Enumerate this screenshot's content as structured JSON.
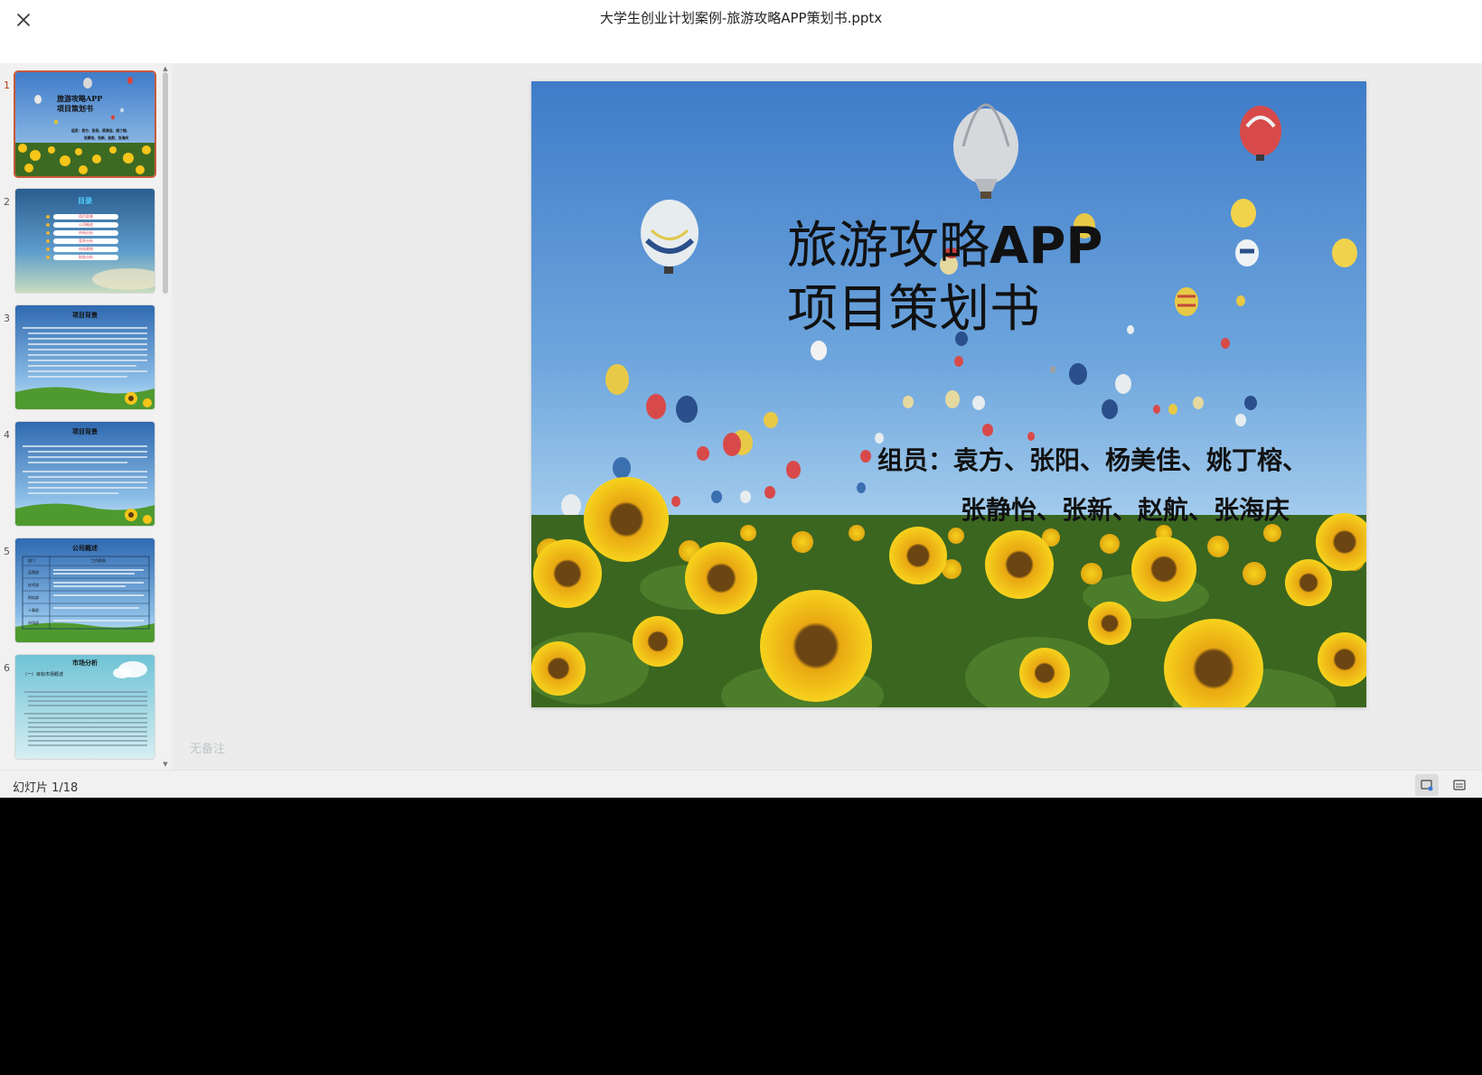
{
  "window": {
    "title": "大学生创业计划案例-旅游攻略APP策划书.pptx"
  },
  "thumbnails": [
    {
      "number": "1",
      "title_line1": "旅游攻略APP",
      "title_line2": "项目策划书",
      "members_line1": "组员：袁方、张阳、杨美佳、姚丁榕、",
      "members_line2": "张静怡、张新、赵航、张海庆"
    },
    {
      "number": "2",
      "title": "目录",
      "items": [
        "项目背景",
        "公司概述",
        "市场分析",
        "竞争分析",
        "市场营销",
        "财务分析"
      ]
    },
    {
      "number": "3",
      "title": "项目背景"
    },
    {
      "number": "4",
      "title": "项目背景"
    },
    {
      "number": "5",
      "title": "公司概述",
      "table_headers": [
        "部门",
        "工作职责"
      ],
      "table_rows": [
        "运营部",
        "技术部",
        "财务部",
        "人事部",
        "市场部"
      ]
    },
    {
      "number": "6",
      "title": "市场分析",
      "subtitle": "（一）目标市场概述"
    }
  ],
  "slide": {
    "title_line1_cn": "旅游攻略",
    "title_line1_latin": "APP",
    "title_line2": "项目策划书",
    "members_line1": "组员：袁方、张阳、杨美佳、姚丁榕、",
    "members_line2": "张静怡、张新、赵航、张海庆"
  },
  "notes": {
    "placeholder": "无备注"
  },
  "status": {
    "slide_counter": "幻灯片 1/18"
  },
  "colors": {
    "active_thumb_border": "#c8593a",
    "sky_top": "#3f7cc9",
    "sky_bottom": "#9cc8ec",
    "sunflower": "#f5c51a",
    "leaf": "#3d6a22"
  },
  "icons": {
    "close": "close-icon",
    "slide_view": "slide-view-icon",
    "notes_view": "notes-view-icon"
  }
}
